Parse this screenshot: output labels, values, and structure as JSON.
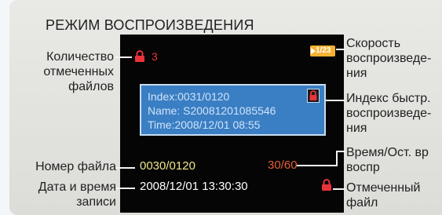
{
  "heading": "РЕЖИМ ВОСПРОИЗВЕДЕНИЯ",
  "labels_left": {
    "marked_count": [
      "Количество",
      "отмеченных",
      "файлов"
    ],
    "file_number": [
      "Номер файла"
    ],
    "record_datetime": [
      "Дата и время",
      "записи"
    ]
  },
  "labels_right": {
    "playback_speed": [
      "Скорость",
      "воспроизведе-",
      "ния"
    ],
    "quick_index": [
      "Индекс быстр.",
      "воспроизведе-",
      "ния"
    ],
    "time_remaining": [
      "Время/Ост. вр",
      "воспр"
    ],
    "marked_file": [
      "Отмеченный",
      "файл"
    ]
  },
  "screen": {
    "marked_count_value": "3",
    "speed_value": "1/23",
    "info": {
      "index": "Index:0031/0120",
      "name": "Name: S20081201085546",
      "time": "Time:2008/12/01 08:55"
    },
    "time_value": "30/60",
    "file_number_value": "0030/0120",
    "datetime_value": "2008/12/01 13:30:30"
  },
  "colors": {
    "screen_bg": "#050505",
    "info_box": "#3a7ec4",
    "lock_red": "#e8333b",
    "yellow_text": "#f0e48a",
    "orange_text": "#e85a3a",
    "speed_icon": "#f7b233"
  }
}
